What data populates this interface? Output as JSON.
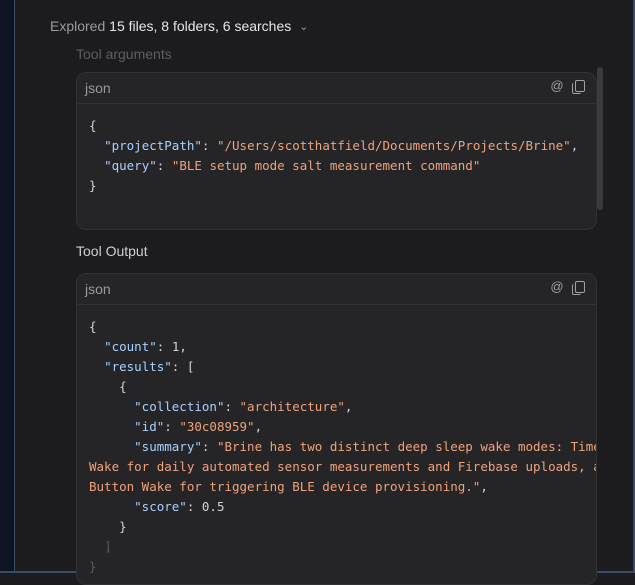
{
  "explored": {
    "prefix": "Explored",
    "detail": "15 files, 8 folders, 6 searches"
  },
  "tool_arguments": {
    "label": "Tool arguments",
    "lang": "json",
    "lines": {
      "open": "{",
      "projectPath_key": "\"projectPath\"",
      "projectPath_val": "\"/Users/scotthatfield/Documents/Projects/Brine\"",
      "query_key": "\"query\"",
      "query_val": "\"BLE setup mode salt measurement command\"",
      "close": "}"
    }
  },
  "tool_output": {
    "label": "Tool Output",
    "lang": "json",
    "lines": {
      "open": "{",
      "count_key": "\"count\"",
      "count_val": "1",
      "results_key": "\"results\"",
      "results_open": "[",
      "item_open": "{",
      "collection_key": "\"collection\"",
      "collection_val": "\"architecture\"",
      "id_key": "\"id\"",
      "id_val": "\"30c08959\"",
      "summary_key": "\"summary\"",
      "summary_val_1": "\"Brine has two distinct deep sleep wake modes: Timer",
      "summary_val_2": "Wake for daily automated sensor measurements and Firebase uploads, and",
      "summary_val_3": "Button Wake for triggering BLE device provisioning.\"",
      "score_key": "\"score\"",
      "score_val": "0.5",
      "item_close": "}",
      "results_close": "]",
      "close": "}"
    }
  },
  "icons": {
    "at": "at-icon",
    "copy": "copy-icon",
    "chevron": "chevron-down-icon"
  }
}
